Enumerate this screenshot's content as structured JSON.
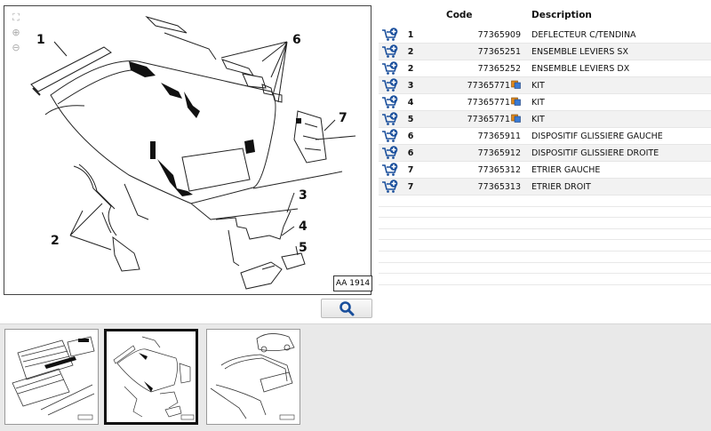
{
  "diagram": {
    "ref_label": "AA 1914",
    "callouts": [
      "1",
      "2",
      "3",
      "4",
      "5",
      "6",
      "7"
    ],
    "tools": [
      "fit-icon",
      "zoom-in-icon",
      "zoom-out-icon"
    ]
  },
  "search_button": {
    "icon": "search-icon"
  },
  "parts_table": {
    "headers": {
      "code": "Code",
      "description": "Description"
    },
    "rows": [
      {
        "ref": "1",
        "code": "77365909",
        "description": "DEFLECTEUR C/TENDINA",
        "kit": false
      },
      {
        "ref": "2",
        "code": "77365251",
        "description": "ENSEMBLE LEVIERS SX",
        "kit": false
      },
      {
        "ref": "2",
        "code": "77365252",
        "description": "ENSEMBLE LEVIERS DX",
        "kit": false
      },
      {
        "ref": "3",
        "code": "77365771",
        "description": "KIT",
        "kit": true
      },
      {
        "ref": "4",
        "code": "77365771",
        "description": "KIT",
        "kit": true
      },
      {
        "ref": "5",
        "code": "77365771",
        "description": "KIT",
        "kit": true
      },
      {
        "ref": "6",
        "code": "77365911",
        "description": "DISPOSITIF GLISSIERE GAUCHE",
        "kit": false
      },
      {
        "ref": "6",
        "code": "77365912",
        "description": "DISPOSITIF GLISSIERE DROITE",
        "kit": false
      },
      {
        "ref": "7",
        "code": "77365312",
        "description": "ETRIER GAUCHE",
        "kit": false
      },
      {
        "ref": "7",
        "code": "77365313",
        "description": "ETRIER DROIT",
        "kit": false
      }
    ]
  },
  "thumbnails": [
    {
      "selected": false
    },
    {
      "selected": true
    },
    {
      "selected": false
    }
  ],
  "colors": {
    "cart_blue": "#1a4f9c",
    "plus_green": "#2e8b3a",
    "kit_orange": "#e08a1e"
  }
}
